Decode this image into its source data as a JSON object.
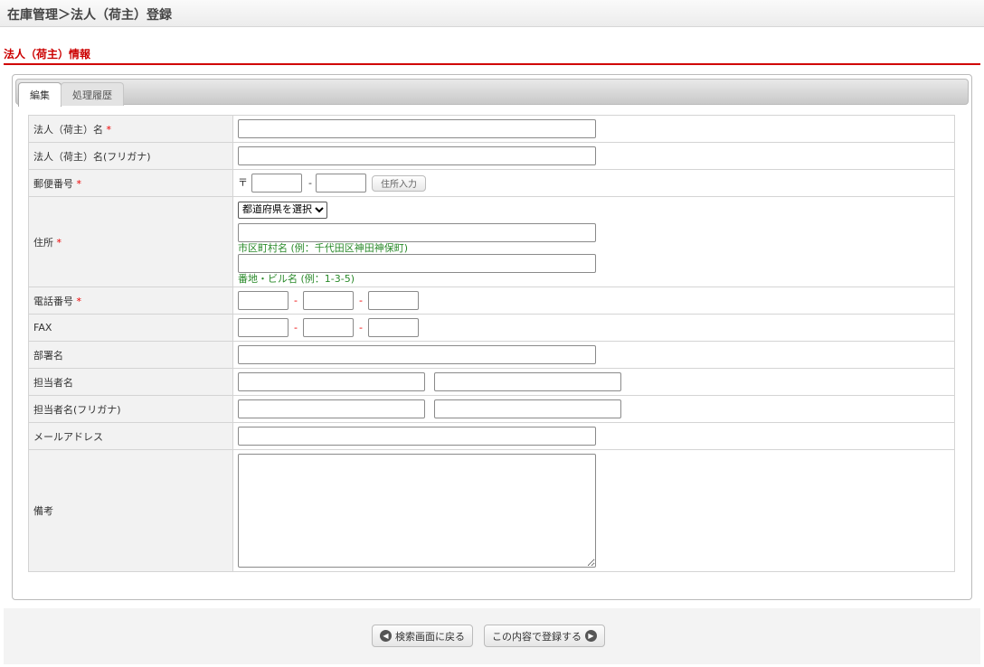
{
  "header": {
    "title": "在庫管理＞法人（荷主）登録"
  },
  "section": {
    "title": "法人（荷主）情報"
  },
  "tabs": [
    {
      "label": "編集"
    },
    {
      "label": "処理履歴"
    }
  ],
  "form": {
    "required_mark": "*",
    "corp_name": "法人（荷主）名",
    "corp_kana": "法人（荷主）名(フリガナ)",
    "postal": "郵便番号",
    "postal_symbol": "〒",
    "postal_sep": "-",
    "address_lookup": "住所入力",
    "address": "住所",
    "pref_select": "都道府県を選択",
    "city_hint": "市区町村名 (例：千代田区神田神保町)",
    "street_hint": "番地・ビル名 (例：1-3-5)",
    "phone": "電話番号",
    "fax": "FAX",
    "sep": "-",
    "dept": "部署名",
    "contact": "担当者名",
    "contact_kana": "担当者名(フリガナ)",
    "email": "メールアドレス",
    "notes": "備考"
  },
  "footer": {
    "back": "検索画面に戻る",
    "submit": "この内容で登録する"
  }
}
